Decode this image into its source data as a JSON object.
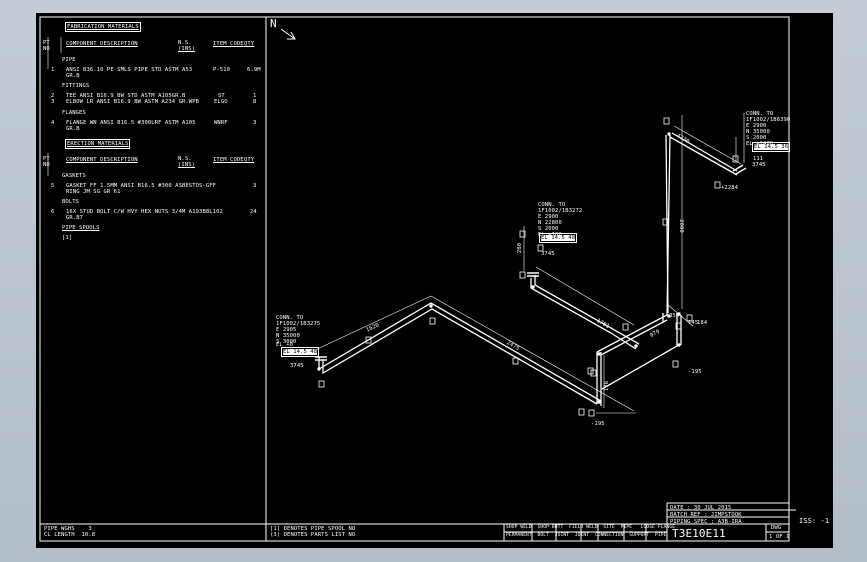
{
  "north_label": "N",
  "bom": {
    "fab_heading": "FABRICATION MATERIALS",
    "col_pt": "PT",
    "col_no": "NO",
    "col_desc": "COMPONENT DESCRIPTION",
    "col_ns1": "N.S.",
    "col_ns2": "(INS)",
    "col_item": "ITEM CODE",
    "col_qty": "QTY",
    "pipe_heading": "PIPE",
    "pipe_item_no": "1",
    "pipe_item_line1": "ANSI B36.10 PE SMLS PIPE STD ASTM A53",
    "pipe_item_line2": "GR.B",
    "pipe_item_code": "P-510",
    "pipe_item_qty": "6.9M",
    "fittings_heading": "FITTINGS",
    "fit1_no": "2",
    "fit1_desc": "TEE ANSI B16.9 BW STD ASTM A105GR.B",
    "fit1_code": "ST",
    "fit1_qty": "1",
    "fit2_no": "3",
    "fit2_desc": "ELBOW LR ANSI B16.9 BW ASTM A234 GR.WPB",
    "fit2_code": "ELGO",
    "fit2_qty": "8",
    "flanges_heading": "FLANGES",
    "fl_no": "4",
    "fl_line1": "FLANGE WN ANSI B16.5 #300LRF ASTM A105",
    "fl_line2": "GR.B",
    "fl_code": "WNRF",
    "fl_qty": "3",
    "erect_heading": "ERECTION MATERIALS",
    "gaskets_heading": "GASKETS",
    "gk_no": "5",
    "gk_line1": "GASKET FF 1.5MM ANSI B16.5 #300 ASBESTOS-GFF",
    "gk_line2": "RING JM SG GR 61",
    "gk_qty": "3",
    "bolts_heading": "BOLTS",
    "bt_no": "6",
    "bt_line1": "16X STUD BOLT C/W HVY HEX NUTS 3/4M A193B8L102",
    "bt_line2": "GR.B7",
    "bt_qty": "24",
    "spools_heading": "PIPE SPOOLS",
    "spool_1": "[1]"
  },
  "annotations": {
    "conn_left": [
      "CONN. TO",
      "1F1002/1B3275",
      "E 2905",
      "N 35000",
      "S 3000",
      "EL +0"
    ],
    "conn_mid": [
      "CONN. TO",
      "1F1002/1B3272",
      "E 2900",
      "N 22800",
      "S 2000",
      "EL +100"
    ],
    "conn_right": [
      "CONN. TO",
      "1F1002/1B6390",
      "E 2900",
      "N 35000",
      "S 2000",
      "EL +2480"
    ],
    "tag_left": "EL 14.5 48",
    "tag_mid": "EL 14.5 48",
    "tag_right": "EL 14.5 36",
    "dims": [
      "1620",
      "2475",
      "4230",
      "1781",
      "979",
      "2000",
      "280",
      "350",
      "176",
      "3745",
      "3745",
      "3745",
      "145",
      "184",
      "111"
    ],
    "els": [
      "-195",
      "-195",
      "+2284"
    ]
  },
  "footer": {
    "pipe_weight": "PIPE WGHS    3",
    "cl_length": "CL LENGTH  10.8",
    "note1": "[1] DENOTES PIPE SPOOL NO",
    "note2": "(3) DENOTES PARTS LIST NO",
    "legend1": "SHOP WELD  SHOP BUTT  FIELD WELD  SITE  PIPE   LOOSE FLANGE",
    "legend2": "PERMANENT  BOLT  JOINT  JOINT  CONNECTION  SUPPORT  PIPE",
    "date": "DATE : 30 JUL 2015",
    "batch": "BATCH REF : JIMPSTOOK",
    "spec": "PIPING SPEC : A3B-IRA",
    "dwg_no": "T3E10E11",
    "dwg_label": "DWG",
    "sheet": "1 OF 1",
    "iss": "ISS: -1"
  }
}
